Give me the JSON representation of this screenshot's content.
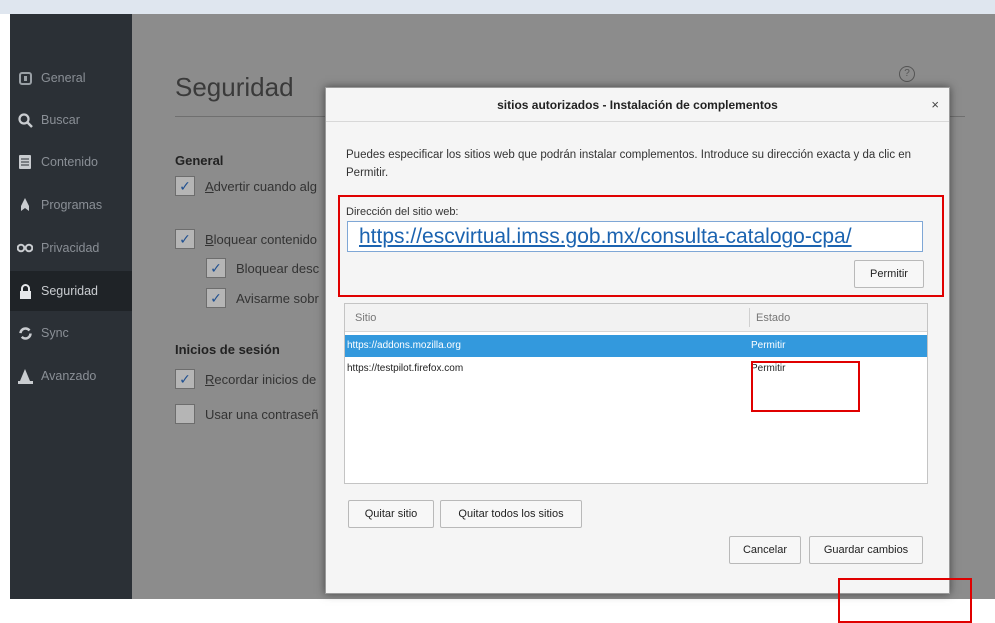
{
  "sidebar": {
    "items": [
      {
        "label": "General",
        "icon": "general-icon"
      },
      {
        "label": "Buscar",
        "icon": "search-icon"
      },
      {
        "label": "Contenido",
        "icon": "document-icon"
      },
      {
        "label": "Programas",
        "icon": "rocket-icon"
      },
      {
        "label": "Privacidad",
        "icon": "mask-icon"
      },
      {
        "label": "Seguridad",
        "icon": "lock-icon"
      },
      {
        "label": "Sync",
        "icon": "sync-icon"
      },
      {
        "label": "Avanzado",
        "icon": "wizard-icon"
      }
    ],
    "active": "Seguridad"
  },
  "page": {
    "title": "Seguridad",
    "help_glyph": "?",
    "general_heading": "General",
    "general_options": [
      {
        "prefix": "A",
        "text": "dvertir cuando alg",
        "checked": true
      },
      {
        "prefix": "B",
        "text": "loquear contenido",
        "checked": true
      },
      {
        "prefix": "",
        "text": "Bloquear desc",
        "checked": true
      },
      {
        "prefix": "",
        "text": "Avisarme sobr",
        "checked": true
      }
    ],
    "login_heading": "Inicios de sesión",
    "login_options": [
      {
        "prefix": "R",
        "text": "ecordar inicios de",
        "checked": true
      },
      {
        "prefix": "",
        "text": "Usar una contraseñ",
        "checked": false
      }
    ]
  },
  "dialog": {
    "title": "sitios autorizados - Instalación de complementos",
    "close_glyph": "×",
    "description": "Puedes especificar los sitios web que podrán instalar complementos. Introduce su dirección exacta y da clic en Permitir.",
    "url_label": "Dirección del sitio web:",
    "url_value": "https://escvirtual.imss.gob.mx/consulta-catalogo-cpa/",
    "permit_button": "Permitir",
    "table": {
      "headers": [
        "Sitio",
        "Estado"
      ],
      "rows": [
        {
          "site": "https://addons.mozilla.org",
          "status": "Permitir",
          "selected": true
        },
        {
          "site": "https://testpilot.firefox.com",
          "status": "Permitir",
          "selected": false
        }
      ]
    },
    "remove_site_button": "Quitar sitio",
    "remove_all_button": "Quitar todos los sitios",
    "cancel_button": "Cancelar",
    "save_button": "Guardar cambios"
  },
  "colors": {
    "sidebar_bg": "#2b3036",
    "overlay_bg": "#8c8c8c",
    "selected_row": "#3399dd",
    "link": "#1b63b0",
    "highlight_red": "#e00000"
  }
}
